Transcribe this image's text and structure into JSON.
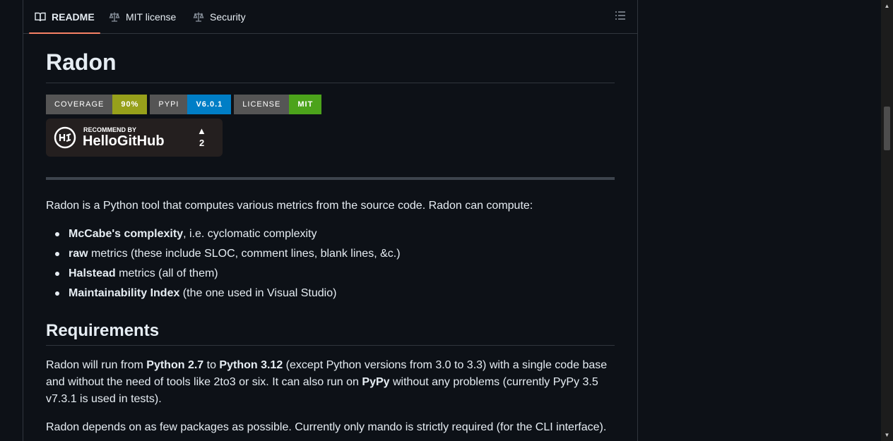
{
  "tabs": [
    {
      "label": "README",
      "icon": "book-icon",
      "active": true
    },
    {
      "label": "MIT license",
      "icon": "law-icon",
      "active": false
    },
    {
      "label": "Security",
      "icon": "law-icon",
      "active": false
    }
  ],
  "readme": {
    "title": "Radon",
    "badges": [
      {
        "label": "COVERAGE",
        "value": "90%",
        "color": "#97a01b"
      },
      {
        "label": "PYPI",
        "value": "V6.0.1",
        "color": "#007ec6"
      },
      {
        "label": "LICENSE",
        "value": "MIT",
        "color": "#4ca31b"
      }
    ],
    "hellogithub": {
      "recommend": "RECOMMEND BY",
      "name": "HelloGitHub",
      "count": "2"
    },
    "intro": "Radon is a Python tool that computes various metrics from the source code. Radon can compute:",
    "metrics": [
      {
        "bold": "McCabe's complexity",
        "rest": ", i.e. cyclomatic complexity"
      },
      {
        "bold": "raw",
        "rest": " metrics (these include SLOC, comment lines, blank lines, &c.)"
      },
      {
        "bold": "Halstead",
        "rest": " metrics (all of them)"
      },
      {
        "bold": "Maintainability Index",
        "rest": " (the one used in Visual Studio)"
      }
    ],
    "requirements_heading": "Requirements",
    "req": {
      "t1": "Radon will run from ",
      "b1": "Python 2.7",
      "t2": " to ",
      "b2": "Python 3.12",
      "t3": " (except Python versions from 3.0 to 3.3) with a single code base and without the need of tools like 2to3 or six. It can also run on ",
      "b3": "PyPy",
      "t4": " without any problems (currently PyPy 3.5 v7.3.1 is used in tests)."
    },
    "deps": "Radon depends on as few packages as possible. Currently only mando is strictly required (for the CLI interface)."
  },
  "colors": {
    "background": "#0d1117",
    "text": "#e6edf3",
    "border": "#30363d",
    "tab_underline": "#f78166"
  }
}
